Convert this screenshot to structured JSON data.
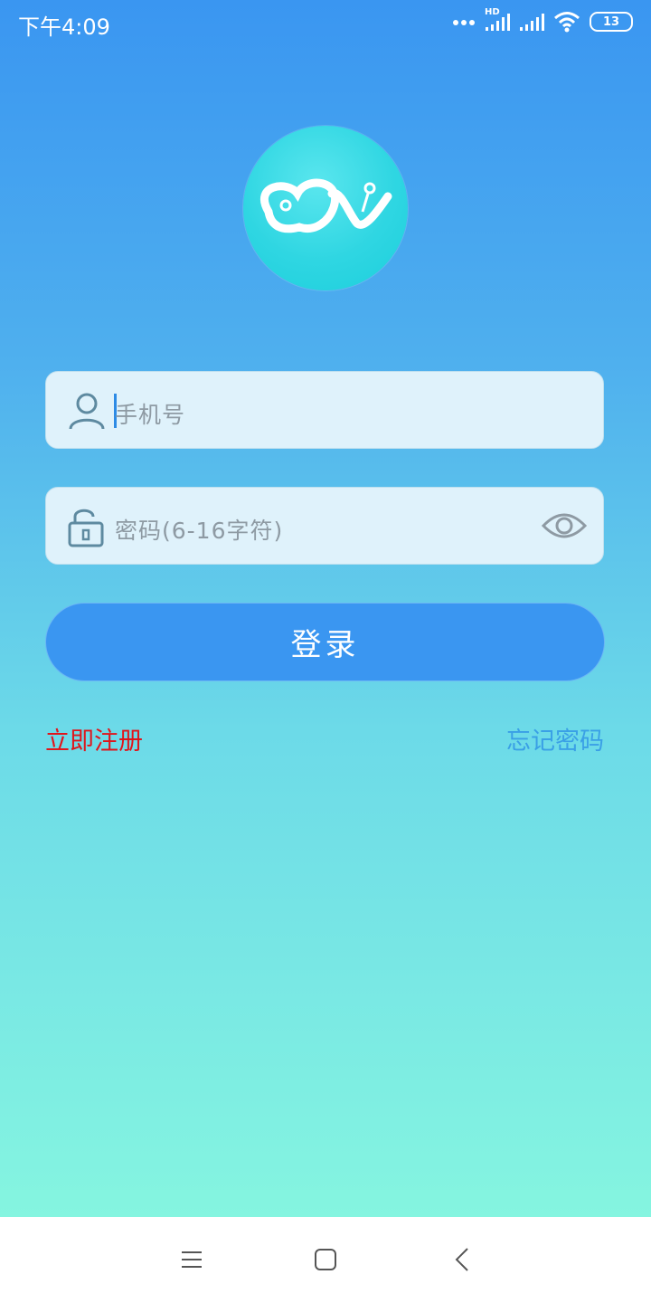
{
  "status_bar": {
    "time": "下午4:09",
    "network_label": "HD",
    "battery_level": "13",
    "icons": [
      "more-dots-icon",
      "signal-icon",
      "signal-icon",
      "wifi-icon",
      "battery-icon"
    ]
  },
  "logo": {
    "icon": "app-logo-mv"
  },
  "phone_field": {
    "placeholder": "手机号",
    "icon": "user-icon"
  },
  "password_field": {
    "placeholder": "密码(6-16字符)",
    "icon": "unlock-icon",
    "toggle_icon": "eye-icon"
  },
  "login_button": {
    "label": "登录"
  },
  "links": {
    "register": "立即注册",
    "forgot": "忘记密码"
  },
  "colors": {
    "primary": "#3a96f1",
    "register": "#e0151b",
    "forgot": "#3aa0e6"
  },
  "nav_bar": {
    "icons": [
      "menu-icon",
      "home-icon",
      "back-icon"
    ]
  }
}
